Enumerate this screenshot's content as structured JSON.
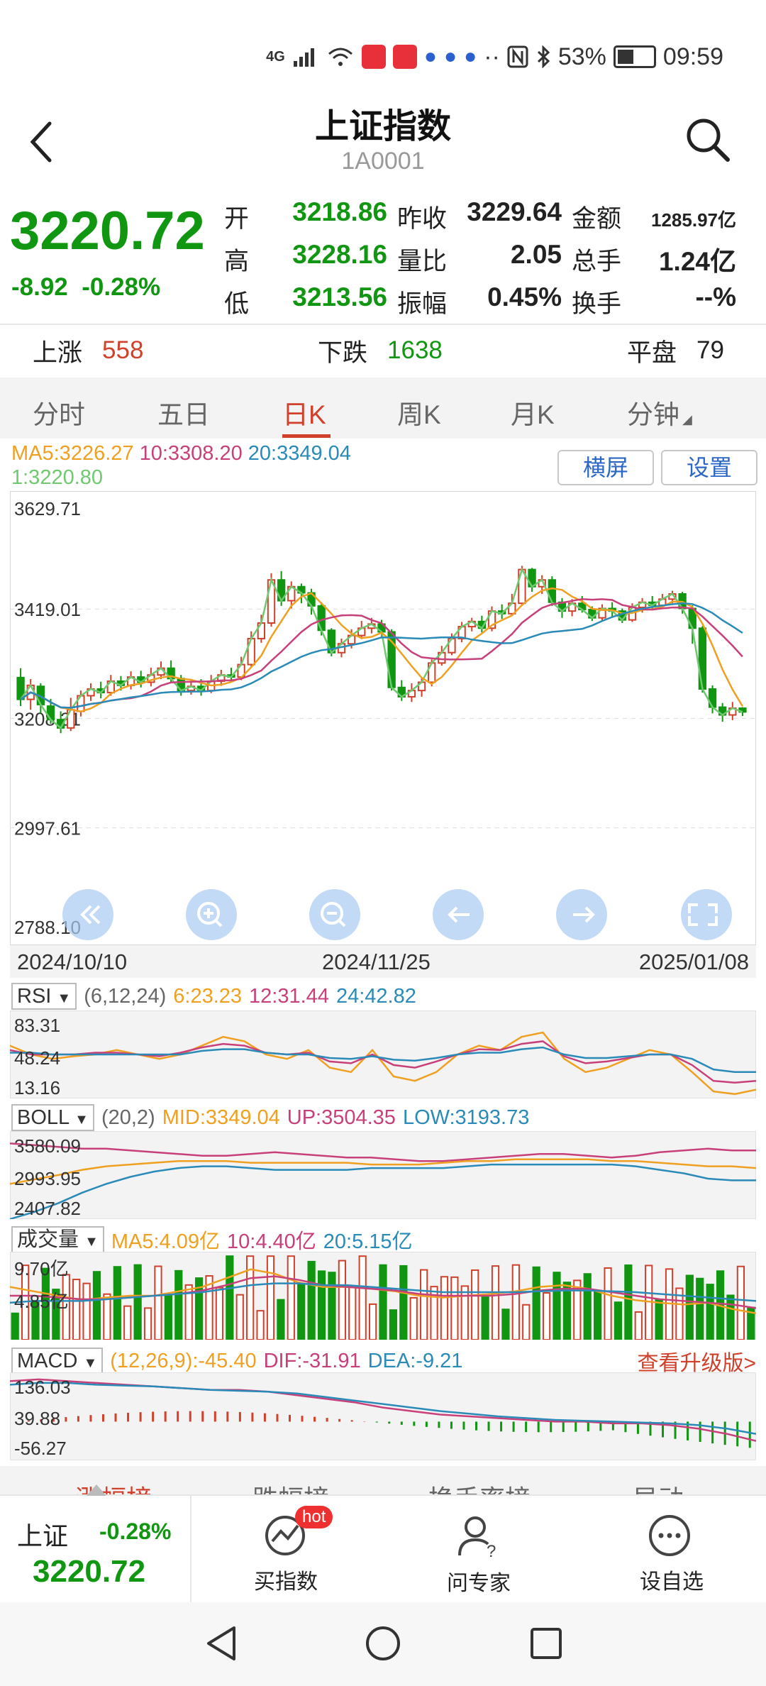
{
  "status_bar": {
    "network": "4G",
    "battery": "53%",
    "battery_level": 0.53,
    "time": "09:59"
  },
  "header": {
    "title": "上证指数",
    "code": "1A0001"
  },
  "quote": {
    "price": "3220.72",
    "change": "-8.92",
    "change_pct": "-0.28%",
    "open_label": "开",
    "open": "3218.86",
    "high_label": "高",
    "high": "3228.16",
    "low_label": "低",
    "low": "3213.56",
    "prev_close_label": "昨收",
    "prev_close": "3229.64",
    "volume_ratio_label": "量比",
    "volume_ratio": "2.05",
    "amplitude_label": "振幅",
    "amplitude": "0.45%",
    "turnover_label": "金额",
    "turnover": "1285.97亿",
    "total_volume_label": "总手",
    "total_volume": "1.24亿",
    "turnover_rate_label": "换手",
    "turnover_rate": "--%"
  },
  "breadth": {
    "up_label": "上涨",
    "up": "558",
    "down_label": "下跌",
    "down": "1638",
    "flat_label": "平盘",
    "flat": "79"
  },
  "tabs": [
    "分时",
    "五日",
    "日K",
    "周K",
    "月K",
    "分钟"
  ],
  "active_tab": "日K",
  "ma": {
    "ma5": "MA5:3226.27",
    "ma10": "10:3308.20",
    "ma20": "20:3349.04",
    "ma1": "1:3220.80"
  },
  "buttons": {
    "landscape": "横屏",
    "settings": "设置"
  },
  "colors": {
    "up": "#d0402a",
    "down": "#109610",
    "ma5": "#f0a020",
    "ma10": "#c8407a",
    "ma20": "#2a8ab8",
    "ma1": "#70c870",
    "accent": "#2a67c6"
  },
  "chart_data": {
    "type": "candlestick",
    "y_ticks": [
      "3629.71",
      "3419.01",
      "3208.31",
      "2997.61",
      "2788.10"
    ],
    "ylim": [
      2788.1,
      3629.71
    ],
    "x_ticks": [
      "2024/10/10",
      "2024/11/25",
      "2025/01/08"
    ],
    "candles": [
      [
        3287,
        3245,
        3305,
        3232
      ],
      [
        3245,
        3272,
        3284,
        3225
      ],
      [
        3270,
        3235,
        3276,
        3218
      ],
      [
        3232,
        3206,
        3246,
        3198
      ],
      [
        3206,
        3190,
        3222,
        3180
      ],
      [
        3190,
        3225,
        3248,
        3184
      ],
      [
        3222,
        3252,
        3262,
        3212
      ],
      [
        3252,
        3265,
        3276,
        3242
      ],
      [
        3265,
        3258,
        3279,
        3247
      ],
      [
        3258,
        3280,
        3292,
        3252
      ],
      [
        3280,
        3272,
        3290,
        3262
      ],
      [
        3272,
        3288,
        3299,
        3264
      ],
      [
        3288,
        3278,
        3300,
        3268
      ],
      [
        3278,
        3292,
        3306,
        3270
      ],
      [
        3292,
        3305,
        3318,
        3284
      ],
      [
        3305,
        3285,
        3320,
        3276
      ],
      [
        3285,
        3262,
        3292,
        3252
      ],
      [
        3262,
        3270,
        3281,
        3254
      ],
      [
        3270,
        3262,
        3284,
        3252
      ],
      [
        3262,
        3280,
        3292,
        3257
      ],
      [
        3280,
        3292,
        3302,
        3271
      ],
      [
        3292,
        3288,
        3306,
        3278
      ],
      [
        3288,
        3312,
        3327,
        3282
      ],
      [
        3312,
        3362,
        3376,
        3306
      ],
      [
        3362,
        3392,
        3408,
        3354
      ],
      [
        3392,
        3475,
        3488,
        3385
      ],
      [
        3475,
        3435,
        3492,
        3425
      ],
      [
        3435,
        3462,
        3472,
        3420
      ],
      [
        3462,
        3450,
        3468,
        3430
      ],
      [
        3450,
        3425,
        3458,
        3408
      ],
      [
        3425,
        3378,
        3432,
        3368
      ],
      [
        3378,
        3335,
        3382,
        3328
      ],
      [
        3335,
        3352,
        3362,
        3326
      ],
      [
        3352,
        3368,
        3380,
        3343
      ],
      [
        3368,
        3382,
        3396,
        3361
      ],
      [
        3382,
        3390,
        3402,
        3372
      ],
      [
        3390,
        3375,
        3398,
        3364
      ],
      [
        3375,
        3268,
        3380,
        3262
      ],
      [
        3268,
        3250,
        3282,
        3242
      ],
      [
        3250,
        3262,
        3276,
        3240
      ],
      [
        3262,
        3278,
        3286,
        3250
      ],
      [
        3278,
        3315,
        3322,
        3270
      ],
      [
        3315,
        3335,
        3348,
        3310
      ],
      [
        3335,
        3362,
        3372,
        3330
      ],
      [
        3362,
        3385,
        3394,
        3355
      ],
      [
        3385,
        3395,
        3402,
        3376
      ],
      [
        3395,
        3382,
        3406,
        3374
      ],
      [
        3382,
        3415,
        3424,
        3376
      ],
      [
        3415,
        3410,
        3428,
        3400
      ],
      [
        3410,
        3430,
        3448,
        3405
      ],
      [
        3430,
        3495,
        3502,
        3426
      ],
      [
        3495,
        3462,
        3498,
        3452
      ],
      [
        3462,
        3475,
        3484,
        3448
      ],
      [
        3475,
        3432,
        3482,
        3425
      ],
      [
        3432,
        3415,
        3440,
        3402
      ],
      [
        3415,
        3430,
        3438,
        3405
      ],
      [
        3430,
        3418,
        3444,
        3412
      ],
      [
        3418,
        3402,
        3424,
        3396
      ],
      [
        3402,
        3420,
        3428,
        3397
      ],
      [
        3420,
        3415,
        3432,
        3404
      ],
      [
        3415,
        3398,
        3420,
        3392
      ],
      [
        3398,
        3422,
        3430,
        3394
      ],
      [
        3422,
        3432,
        3440,
        3412
      ],
      [
        3432,
        3426,
        3444,
        3420
      ],
      [
        3426,
        3438,
        3448,
        3422
      ],
      [
        3438,
        3448,
        3454,
        3430
      ],
      [
        3448,
        3420,
        3452,
        3410
      ],
      [
        3420,
        3382,
        3426,
        3352
      ],
      [
        3382,
        3265,
        3386,
        3258
      ],
      [
        3265,
        3230,
        3272,
        3218
      ],
      [
        3230,
        3215,
        3238,
        3202
      ],
      [
        3215,
        3228,
        3240,
        3205
      ],
      [
        3228,
        3220.72,
        3230,
        3213
      ]
    ]
  },
  "rsi": {
    "label": "RSI",
    "params": "(6,12,24)",
    "rsi6": "6:23.23",
    "rsi12": "12:31.44",
    "rsi24": "24:42.82",
    "y_ticks": [
      "83.31",
      "48.24",
      "13.16"
    ]
  },
  "boll": {
    "label": "BOLL",
    "params": "(20,2)",
    "mid": "MID:3349.04",
    "up": "UP:3504.35",
    "low": "LOW:3193.73",
    "y_ticks": [
      "3580.09",
      "2993.95",
      "2407.82"
    ]
  },
  "volume": {
    "label": "成交量",
    "ma5": "MA5:4.09亿",
    "ma10": "10:4.40亿",
    "ma20": "20:5.15亿",
    "y_ticks": [
      "9.70亿",
      "4.85亿"
    ]
  },
  "macd": {
    "label": "MACD",
    "params": "(12,26,9):-45.40",
    "dif": "DIF:-31.91",
    "dea": "DEA:-9.21",
    "upgrade": "查看升级版>",
    "y_ticks": [
      "136.03",
      "39.88",
      "-56.27"
    ]
  },
  "peek_tabs": [
    "涨幅榜",
    "跌幅榜",
    "换手率榜",
    "异动"
  ],
  "bottom": {
    "index_name": "上证",
    "index_pct": "-0.28%",
    "index_price": "3220.72",
    "buy_index": "买指数",
    "hot_badge": "hot",
    "ask_expert": "问专家",
    "add_watch": "设自选"
  }
}
